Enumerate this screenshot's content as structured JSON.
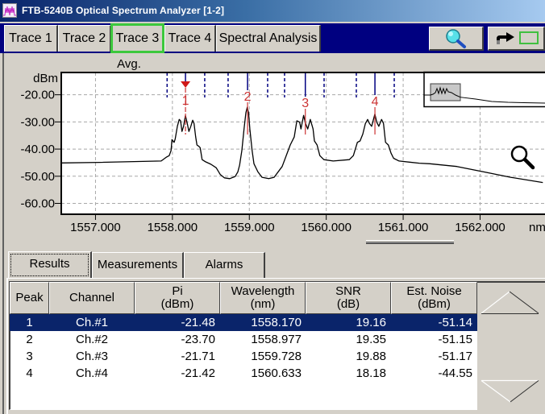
{
  "window": {
    "title": "FTB-5240B Optical Spectrum Analyzer [1-2]",
    "icon": "spectrum-app-icon"
  },
  "trace_tabs": [
    {
      "label": "Trace 1",
      "selected": false
    },
    {
      "label": "Trace 2",
      "selected": false
    },
    {
      "label": "Trace 3",
      "selected": true
    },
    {
      "label": "Trace 4",
      "selected": false
    },
    {
      "label": "Spectral Analysis",
      "selected": false
    }
  ],
  "toolbar": {
    "zoom_button_icon": "magnifier-icon",
    "export_button_icon": "arrow-to-box-icon"
  },
  "chart_data": {
    "type": "line",
    "title": "Avg.",
    "ylabel": "dBm",
    "xlabel": "nm",
    "xlim": [
      1556.555,
      1562.844
    ],
    "ylim": [
      -64.0,
      -11.8
    ],
    "grid": true,
    "xticks": [
      1557,
      1558,
      1559,
      1560,
      1561,
      1562
    ],
    "xtick_labels": [
      "1557.000",
      "1558.000",
      "1559.000",
      "1560.000",
      "1561.000",
      "1562.000"
    ],
    "yticks": [
      -20,
      -30,
      -40,
      -50,
      -60
    ],
    "ytick_labels": [
      "-20.00",
      "-30.00",
      "-40.00",
      "-50.00",
      "-60.00"
    ],
    "series": [
      {
        "name": "Trace 3",
        "points": [
          [
            1556.555,
            -45.1
          ],
          [
            1557.05,
            -44.9
          ],
          [
            1557.854,
            -44.4
          ],
          [
            1557.925,
            -42.9
          ],
          [
            1557.959,
            -42.4
          ],
          [
            1557.983,
            -40.5
          ],
          [
            1557.994,
            -36.5
          ],
          [
            1558.022,
            -37.5
          ],
          [
            1558.036,
            -36.3
          ],
          [
            1558.064,
            -31.6
          ],
          [
            1558.088,
            -29.1
          ],
          [
            1558.106,
            -29.6
          ],
          [
            1558.124,
            -33.5
          ],
          [
            1558.145,
            -31.6
          ],
          [
            1558.169,
            -27.6
          ],
          [
            1558.193,
            -30.6
          ],
          [
            1558.214,
            -33.5
          ],
          [
            1558.239,
            -31.6
          ],
          [
            1558.263,
            -29.4
          ],
          [
            1558.281,
            -30.6
          ],
          [
            1558.302,
            -35.5
          ],
          [
            1558.319,
            -38.5
          ],
          [
            1558.344,
            -39.0
          ],
          [
            1558.361,
            -39.5
          ],
          [
            1558.386,
            -43.9
          ],
          [
            1558.431,
            -44.7
          ],
          [
            1558.501,
            -45.6
          ],
          [
            1558.57,
            -46.9
          ],
          [
            1558.623,
            -49.4
          ],
          [
            1558.675,
            -50.6
          ],
          [
            1558.745,
            -50.9
          ],
          [
            1558.816,
            -50.1
          ],
          [
            1558.85,
            -48.4
          ],
          [
            1558.874,
            -45.9
          ],
          [
            1558.903,
            -40.5
          ],
          [
            1558.931,
            -32.6
          ],
          [
            1558.955,
            -26.6
          ],
          [
            1558.973,
            -24.6
          ],
          [
            1558.99,
            -26.6
          ],
          [
            1559.007,
            -32.6
          ],
          [
            1559.036,
            -40.5
          ],
          [
            1559.06,
            -45.4
          ],
          [
            1559.112,
            -48.4
          ],
          [
            1559.165,
            -50.4
          ],
          [
            1559.252,
            -50.9
          ],
          [
            1559.322,
            -50.4
          ],
          [
            1559.427,
            -46.4
          ],
          [
            1559.532,
            -38.5
          ],
          [
            1559.584,
            -35.5
          ],
          [
            1559.618,
            -29.6
          ],
          [
            1559.654,
            -30.1
          ],
          [
            1559.671,
            -32.6
          ],
          [
            1559.706,
            -27.6
          ],
          [
            1559.731,
            -30.6
          ],
          [
            1559.759,
            -32.6
          ],
          [
            1559.793,
            -29.1
          ],
          [
            1559.828,
            -32.6
          ],
          [
            1559.846,
            -37.0
          ],
          [
            1559.881,
            -38.5
          ],
          [
            1559.916,
            -42.4
          ],
          [
            1559.969,
            -43.9
          ],
          [
            1560.09,
            -44.4
          ],
          [
            1560.3,
            -43.9
          ],
          [
            1560.352,
            -42.4
          ],
          [
            1560.405,
            -37.5
          ],
          [
            1560.44,
            -37.0
          ],
          [
            1560.475,
            -34.5
          ],
          [
            1560.509,
            -30.6
          ],
          [
            1560.538,
            -29.1
          ],
          [
            1560.562,
            -30.6
          ],
          [
            1560.59,
            -31.6
          ],
          [
            1560.632,
            -27.1
          ],
          [
            1560.656,
            -30.1
          ],
          [
            1560.684,
            -31.6
          ],
          [
            1560.719,
            -29.1
          ],
          [
            1560.744,
            -30.6
          ],
          [
            1560.771,
            -37.5
          ],
          [
            1560.807,
            -38.5
          ],
          [
            1560.842,
            -41.5
          ],
          [
            1560.876,
            -43.4
          ],
          [
            1560.947,
            -44.4
          ],
          [
            1561.209,
            -45.2
          ],
          [
            1561.348,
            -45.4
          ],
          [
            1561.698,
            -46.4
          ],
          [
            1562.047,
            -48.4
          ],
          [
            1562.396,
            -50.4
          ],
          [
            1562.816,
            -52.3
          ]
        ]
      }
    ],
    "peak_markers": [
      {
        "label": "1",
        "wavelength": 1558.17,
        "active": true
      },
      {
        "label": "2",
        "wavelength": 1558.977,
        "active": false
      },
      {
        "label": "3",
        "wavelength": 1559.728,
        "active": false
      },
      {
        "label": "4",
        "wavelength": 1560.633,
        "active": false
      }
    ],
    "channel_boundaries": [
      1557.931,
      1558.42,
      1558.724,
      1559.238,
      1559.458,
      1559.972,
      1560.391,
      1560.884
    ],
    "legend": "none"
  },
  "result_tabs": [
    {
      "label": "Results",
      "selected": true
    },
    {
      "label": "Measurements",
      "selected": false
    },
    {
      "label": "Alarms",
      "selected": false
    }
  ],
  "results_table": {
    "columns": [
      {
        "title": "Peak",
        "unit": ""
      },
      {
        "title": "Channel",
        "unit": ""
      },
      {
        "title": "Pi",
        "unit": "(dBm)"
      },
      {
        "title": "Wavelength",
        "unit": "(nm)"
      },
      {
        "title": "SNR",
        "unit": "(dB)"
      },
      {
        "title": "Est. Noise",
        "unit": "(dBm)"
      }
    ],
    "rows": [
      {
        "peak": "1",
        "channel": "Ch.#1",
        "pi": "-21.48",
        "wavelength": "1558.170",
        "snr": "19.16",
        "est_noise": "-51.14"
      },
      {
        "peak": "2",
        "channel": "Ch.#2",
        "pi": "-23.70",
        "wavelength": "1558.977",
        "snr": "19.35",
        "est_noise": "-51.15"
      },
      {
        "peak": "3",
        "channel": "Ch.#3",
        "pi": "-21.71",
        "wavelength": "1559.728",
        "snr": "19.88",
        "est_noise": "-51.17"
      },
      {
        "peak": "4",
        "channel": "Ch.#4",
        "pi": "-21.42",
        "wavelength": "1560.633",
        "snr": "18.18",
        "est_noise": "-44.55"
      }
    ],
    "selected_row_index": 0,
    "scroll_up_icon": "triangle-up-icon",
    "scroll_down_icon": "triangle-down-icon"
  },
  "colors": {
    "selection": "#0a246a",
    "trace": "#000000",
    "marker": "#000080",
    "peak_label": "#cc3333",
    "active_tab_outline": "#3cc83c",
    "tab_strip": "#000080"
  }
}
